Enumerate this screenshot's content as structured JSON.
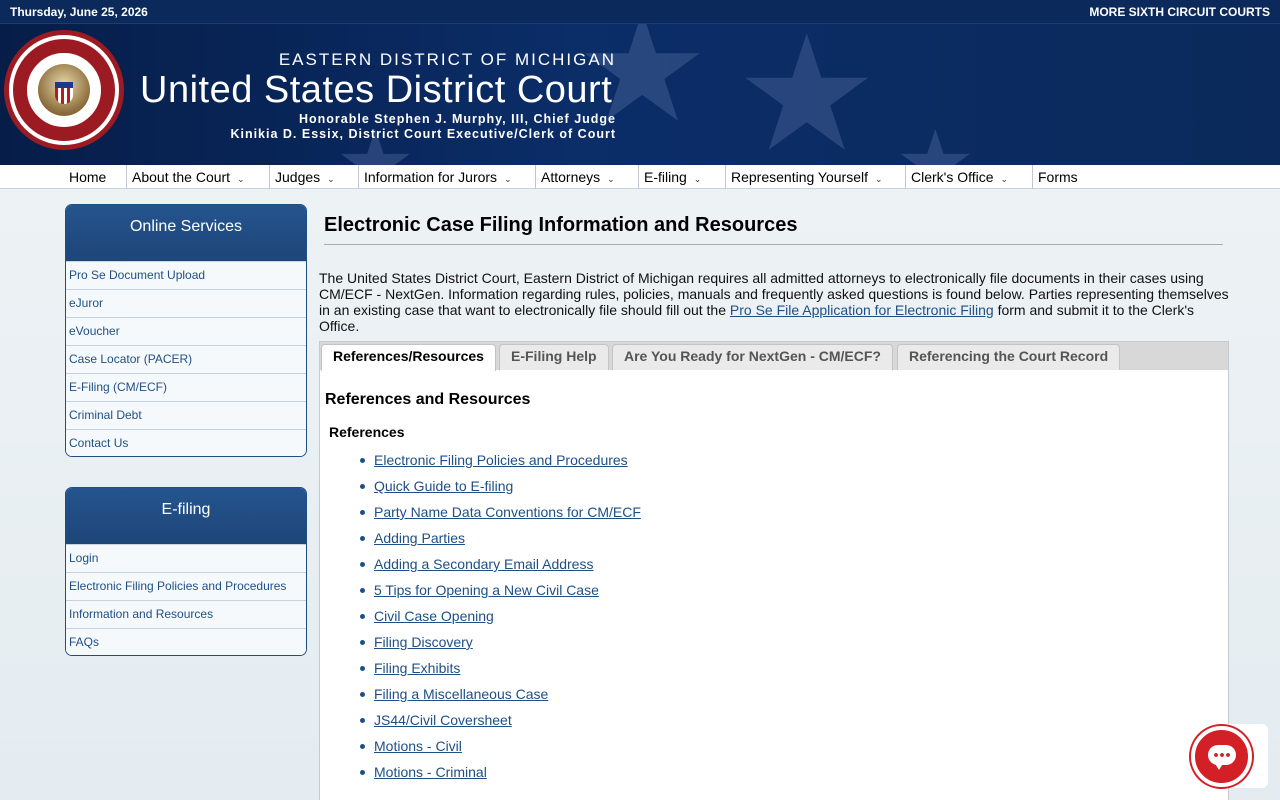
{
  "topbar": {
    "date": "Thursday, June 25, 2026",
    "more_link": "MORE SIXTH CIRCUIT COURTS"
  },
  "banner": {
    "seal_label": "United States District Court · Eastern District of Michigan",
    "district": "EASTERN DISTRICT OF MICHIGAN",
    "court": "United States District Court",
    "chief_judge": "Honorable Stephen J. Murphy, III, Chief Judge",
    "clerk": "Kinikia D. Essix, District Court Executive/Clerk of Court"
  },
  "nav": {
    "items": [
      {
        "label": "Home",
        "has_menu": false
      },
      {
        "label": "About the Court",
        "has_menu": true
      },
      {
        "label": "Judges",
        "has_menu": true
      },
      {
        "label": "Information for Jurors",
        "has_menu": true
      },
      {
        "label": "Attorneys",
        "has_menu": true
      },
      {
        "label": "E-filing",
        "has_menu": true
      },
      {
        "label": "Representing Yourself",
        "has_menu": true
      },
      {
        "label": "Clerk's Office",
        "has_menu": true
      },
      {
        "label": "Forms",
        "has_menu": false
      }
    ]
  },
  "sidebar": {
    "online_services": {
      "title": "Online Services",
      "items": [
        "Pro Se Document Upload",
        "eJuror",
        "eVoucher",
        "Case Locator (PACER)",
        "E-Filing (CM/ECF)",
        "Criminal Debt",
        "Contact Us"
      ]
    },
    "efiling": {
      "title": "E-filing",
      "items": [
        "Login",
        "Electronic Filing Policies and Procedures",
        "Information and Resources",
        "FAQs"
      ]
    }
  },
  "main": {
    "title": "Electronic Case Filing Information and Resources",
    "intro_before": "The United States District Court, Eastern District of Michigan requires all admitted attorneys to electronically file documents in their cases using CM/ECF - NextGen. Information regarding rules, policies, manuals and frequently asked questions is found below. Parties representing themselves in an existing case that want to electronically file should fill out the ",
    "intro_link": "Pro Se File Application for Electronic Filing",
    "intro_after": " form and submit it to the Clerk's Office.",
    "tabs": [
      "References/Resources",
      "E-Filing Help",
      "Are You Ready for NextGen - CM/ECF?",
      "Referencing the Court Record"
    ],
    "active_tab": "References/Resources",
    "panel_heading": "References and Resources",
    "section_heading": "References",
    "links": [
      "Electronic Filing Policies and Procedures",
      "Quick Guide to E-filing",
      "Party Name Data Conventions for CM/ECF",
      "Adding Parties",
      "Adding a Secondary Email Address",
      "5 Tips for Opening a New Civil Case",
      "Civil Case Opening",
      "Filing Discovery",
      "Filing Exhibits",
      "Filing a Miscellaneous Case",
      "JS44/Civil Coversheet",
      "Motions - Civil",
      "Motions - Criminal"
    ]
  },
  "colors": {
    "navy": "#0b2a5b",
    "link": "#1f4f85",
    "chat": "#d31f26"
  }
}
